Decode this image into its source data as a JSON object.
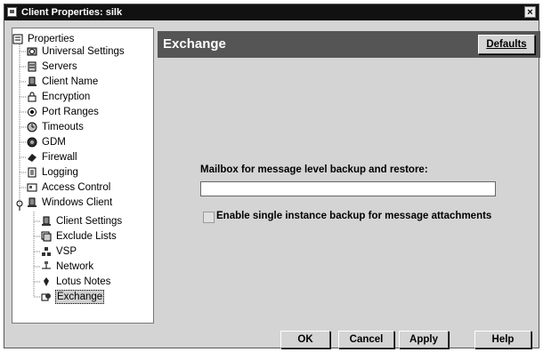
{
  "window": {
    "title": "Client Properties: silk",
    "close_glyph": "×"
  },
  "tree": {
    "items": [
      {
        "label": "Properties",
        "icon": "properties-icon"
      },
      {
        "label": "Universal Settings",
        "icon": "universal-settings-icon"
      },
      {
        "label": "Servers",
        "icon": "servers-icon"
      },
      {
        "label": "Client Name",
        "icon": "client-name-icon"
      },
      {
        "label": "Encryption",
        "icon": "lock-icon"
      },
      {
        "label": "Port Ranges",
        "icon": "port-ranges-icon"
      },
      {
        "label": "Timeouts",
        "icon": "timeouts-icon"
      },
      {
        "label": "GDM",
        "icon": "gdm-icon"
      },
      {
        "label": "Firewall",
        "icon": "firewall-icon"
      },
      {
        "label": "Logging",
        "icon": "logging-icon"
      },
      {
        "label": "Access Control",
        "icon": "access-control-icon"
      },
      {
        "label": "Windows Client",
        "icon": "windows-client-icon"
      },
      {
        "label": "Client Settings",
        "icon": "client-settings-icon"
      },
      {
        "label": "Exclude Lists",
        "icon": "exclude-lists-icon"
      },
      {
        "label": "VSP",
        "icon": "vsp-icon"
      },
      {
        "label": "Network",
        "icon": "network-icon"
      },
      {
        "label": "Lotus Notes",
        "icon": "lotus-notes-icon"
      },
      {
        "label": "Exchange",
        "icon": "exchange-icon"
      }
    ],
    "selected_label": "Exchange"
  },
  "panel": {
    "title": "Exchange",
    "defaults_button": "Defaults",
    "mailbox_label": "Mailbox for message level backup and restore:",
    "mailbox_value": "",
    "checkbox_label": "Enable single instance backup for message attachments",
    "checkbox_checked": false
  },
  "buttons": {
    "ok": "OK",
    "cancel": "Cancel",
    "apply": "Apply",
    "help": "Help"
  }
}
